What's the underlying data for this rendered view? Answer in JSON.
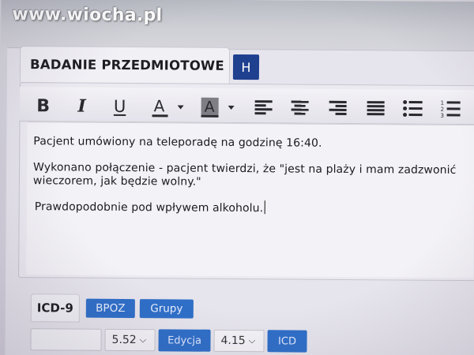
{
  "watermark": "www.wiocha.pl",
  "section": {
    "tab_title": "BADANIE PRZEDMIOTOWE",
    "tab_h_label": "H"
  },
  "toolbar": {
    "bold": "B",
    "italic": "I",
    "underline": "U",
    "font_color_letter": "A",
    "bg_color_letter": "A",
    "icons": [
      "bold-icon",
      "italic-icon",
      "underline-icon",
      "font-color-icon",
      "background-color-icon",
      "align-left-icon",
      "align-center-icon",
      "align-right-icon",
      "justify-icon",
      "bullet-list-icon",
      "numbered-list-icon"
    ]
  },
  "editor": {
    "paragraph1": "Pacjent umówiony na teleporadę na godzinę 16:40.",
    "paragraph2_line1": "Wykonano połączenie - pacjent twierdzi, że \"jest na plaży i mam zadzwonić",
    "paragraph2_line2": "wieczorem, jak będzie wolny.\"",
    "paragraph3": "Prawdopodobnie pod wpływem alkoholu."
  },
  "icd": {
    "label": "ICD-9",
    "button_bpoz": "BPOZ",
    "button_grupy": "Grupy"
  },
  "row2": {
    "select1_value": "5.52",
    "edit_button": "Edycja",
    "select2_value": "4.15",
    "icd_button": "ICD"
  },
  "colors": {
    "accent_blue": "#2f6fc8",
    "dark_blue": "#1f3f8f"
  }
}
